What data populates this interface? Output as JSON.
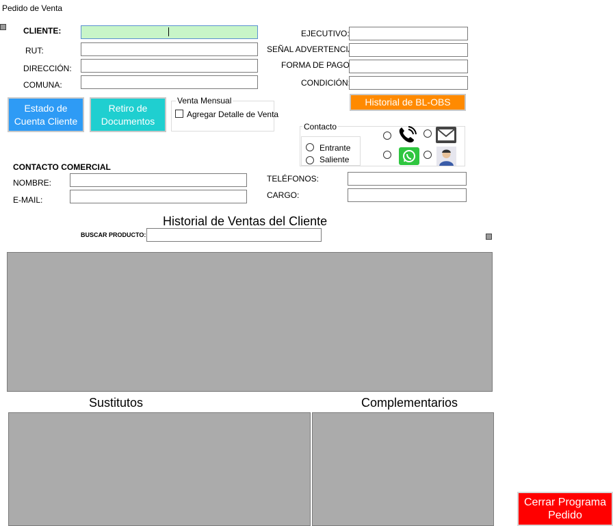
{
  "window": {
    "title": "Pedido de Venta"
  },
  "client": {
    "cliente_label": "CLIENTE:",
    "rut_label": "RUT:",
    "direccion_label": "DIRECCIÓN:",
    "comuna_label": "COMUNA:",
    "cliente_value": "",
    "rut_value": "",
    "direccion_value": "",
    "comuna_value": ""
  },
  "account": {
    "ejecutivo_label": "EJECUTIVO:",
    "senal_label": "SEÑAL ADVERTENCIA:",
    "forma_pago_label": "FORMA DE PAGO:",
    "condicion_label": "CONDICIÓN:",
    "ejecutivo_value": "",
    "senal_value": "",
    "forma_pago_value": "",
    "condicion_value": ""
  },
  "buttons": {
    "estado_cuenta": "Estado de Cuenta Cliente",
    "retiro_documentos": "Retiro de Documentos",
    "historial_bl_obs": "Historial de BL-OBS",
    "cerrar_programa": "Cerrar Programa Pedido"
  },
  "venta_mensual": {
    "legend": "Venta Mensual",
    "checkbox_label": "Agregar Detalle de Venta",
    "checked": false
  },
  "contacto": {
    "legend": "Contacto",
    "entrante": "Entrante",
    "saliente": "Saliente",
    "icons": [
      "phone-icon",
      "email-icon",
      "whatsapp-icon",
      "person-icon"
    ]
  },
  "contacto_comercial": {
    "title": "CONTACTO COMERCIAL",
    "nombre_label": "NOMBRE:",
    "email_label": "E-MAIL:",
    "telefonos_label": "TELÉFONOS:",
    "cargo_label": "CARGO:"
  },
  "historial": {
    "title": "Historial de Ventas del Cliente",
    "buscar_label": "BUSCAR PRODUCTO:",
    "buscar_value": ""
  },
  "sustitutos": {
    "title": "Sustitutos"
  },
  "complementarios": {
    "title": "Complementarios"
  },
  "colors": {
    "blue_button": "#2e9bf5",
    "teal_button": "#1fcfd0",
    "orange_button": "#ff8a00",
    "red_button": "#ff0000",
    "grid_gray": "#ababab",
    "active_field": "#c8f5c8"
  }
}
